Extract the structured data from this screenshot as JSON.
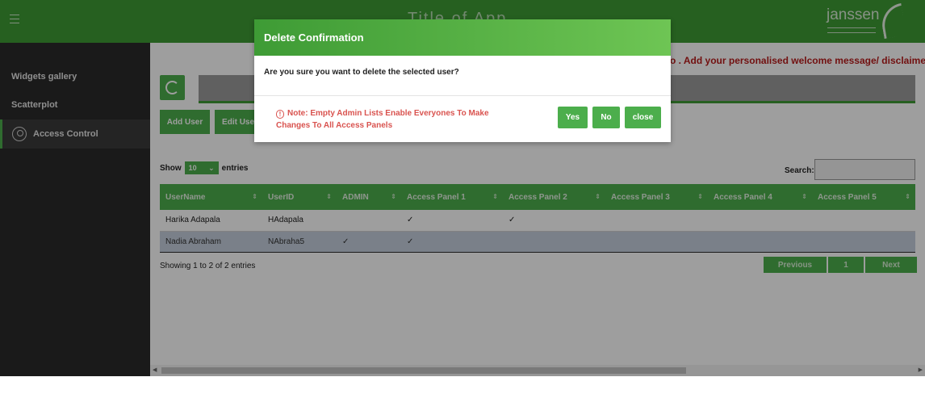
{
  "app": {
    "title": "Title of App",
    "logo_text": "janssen"
  },
  "sidebar": {
    "items": [
      {
        "label": "Widgets gallery"
      },
      {
        "label": "Scatterplot"
      },
      {
        "label": "Access Control",
        "active": true
      }
    ]
  },
  "main": {
    "welcome": "o . Add your personalised welcome message/ disclaimer/ gen",
    "buttons": {
      "add_user": "Add User",
      "edit_user": "Edit User"
    },
    "length": {
      "show": "Show",
      "value": "10",
      "entries": "entries"
    },
    "search": {
      "label": "Search:",
      "value": ""
    },
    "table": {
      "columns": [
        "UserName",
        "UserID",
        "ADMIN",
        "Access Panel 1",
        "Access Panel 2",
        "Access Panel 3",
        "Access Panel 4",
        "Access Panel 5"
      ],
      "rows": [
        [
          "Harika Adapala",
          "HAdapala",
          "",
          "✓",
          "✓",
          "",
          "",
          ""
        ],
        [
          "Nadia Abraham",
          "NAbraha5",
          "✓",
          "✓",
          "",
          "",
          "",
          ""
        ]
      ]
    },
    "info": "Showing 1 to 2 of 2 entries",
    "pagination": {
      "previous": "Previous",
      "page": "1",
      "next": "Next"
    }
  },
  "modal": {
    "title": "Delete Confirmation",
    "message": "Are you sure you want to delete the selected user?",
    "note_line1": "Note: Empty Admin Lists Enable Everyones To Make",
    "note_line2": "Changes To All Access Panels",
    "yes": "Yes",
    "no": "No",
    "close": "close"
  },
  "colors": {
    "brand_green": "#4cae4c",
    "header_green": "#3e9b35",
    "sidebar_dark": "#2a2a2a",
    "warning_red": "#d9534f"
  },
  "icons": [
    "menu-icon",
    "refresh-icon",
    "user-access-icon",
    "warning-icon",
    "chevron-down-icon",
    "sort-icon",
    "check-icon"
  ]
}
